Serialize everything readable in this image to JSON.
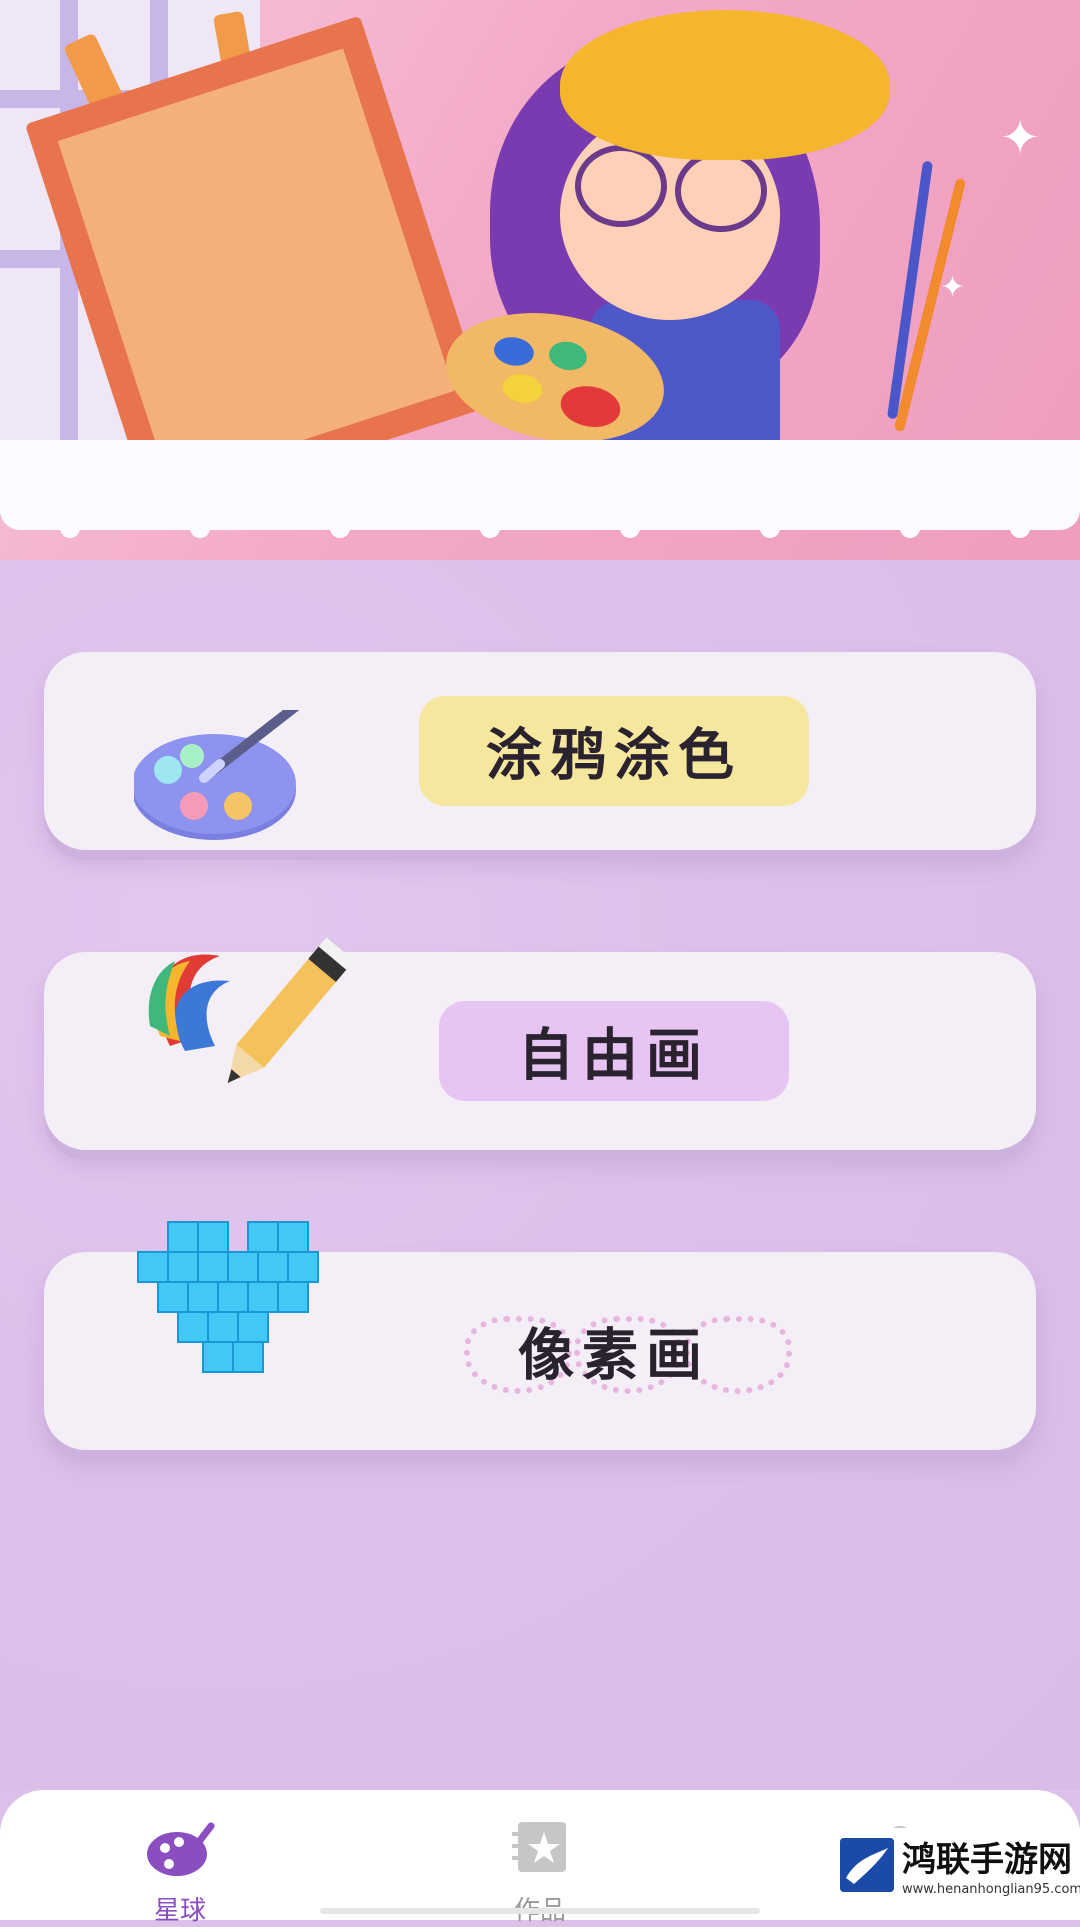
{
  "menu": {
    "items": [
      {
        "label": "涂鸦涂色",
        "icon": "paint-palette-icon",
        "accent": "#f6e79e"
      },
      {
        "label": "自由画",
        "icon": "pencil-swoosh-icon",
        "accent": "#e7c5f3"
      },
      {
        "label": "像素画",
        "icon": "pixel-heart-icon",
        "accent": "#e6b6df"
      }
    ]
  },
  "tabbar": {
    "tabs": [
      {
        "label": "星球",
        "icon": "palette-tab-icon",
        "active": true
      },
      {
        "label": "作品",
        "icon": "works-star-icon",
        "active": false
      },
      {
        "label": "",
        "icon": "profile-icon",
        "active": false
      }
    ],
    "active_color": "#8a4ec1",
    "inactive_color": "#b4b4b4"
  },
  "watermark": {
    "text": "鸿联手游网",
    "url": "www.henanhonglian95.com"
  }
}
